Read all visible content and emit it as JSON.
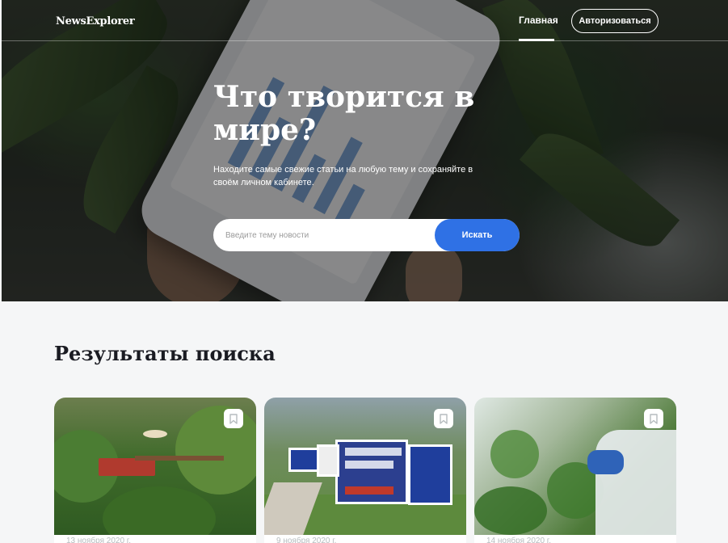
{
  "header": {
    "logo": "NewsExplorer",
    "nav_home": "Главная",
    "auth_button": "Авторизоваться"
  },
  "hero": {
    "title": "Что творится в мире?",
    "subtitle": "Находите самые свежие статьи на любую тему и сохраняйте в своём личном кабинете.",
    "search_placeholder": "Введите тему новости",
    "search_button": "Искать"
  },
  "results": {
    "title": "Результаты поиска",
    "cards": [
      {
        "date": "13 ноября 2020 г.",
        "icon": "bookmark-icon"
      },
      {
        "date": "9 ноября 2020 г.",
        "icon": "bookmark-icon"
      },
      {
        "date": "14 ноября 2020 г.",
        "icon": "bookmark-icon"
      }
    ]
  },
  "colors": {
    "accent": "#2f71e5",
    "text_dark": "#1a1b22",
    "date_grey": "#b6bcbf"
  }
}
